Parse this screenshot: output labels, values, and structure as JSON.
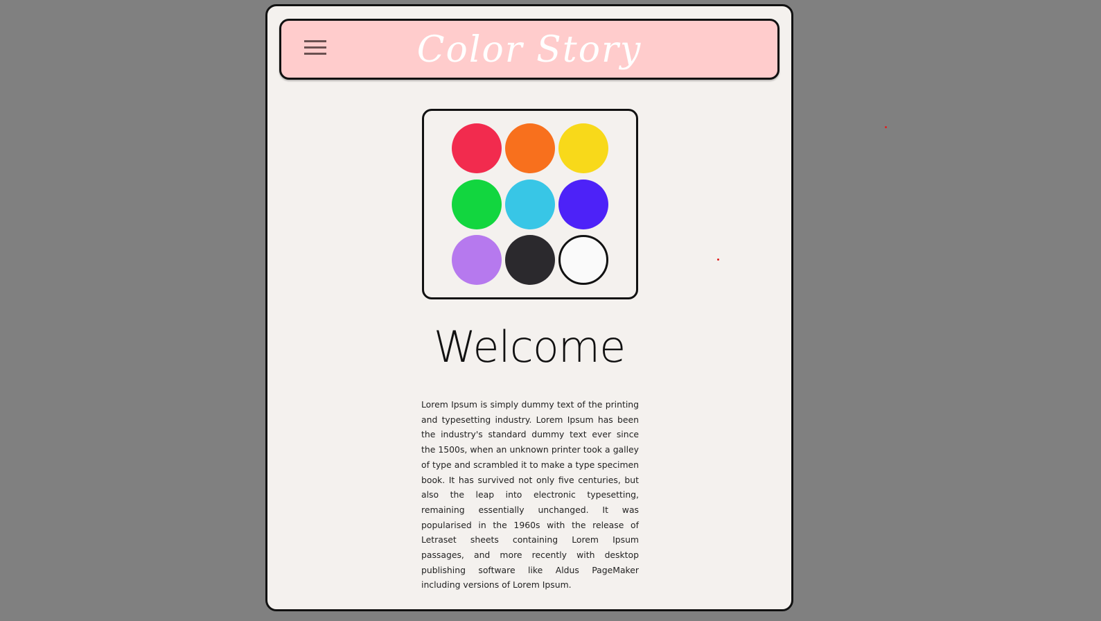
{
  "header": {
    "title": "Color Story",
    "menu_icon": "hamburger-menu-icon"
  },
  "palette": {
    "colors": [
      {
        "name": "red",
        "hex": "#f22b4e"
      },
      {
        "name": "orange",
        "hex": "#f8701d"
      },
      {
        "name": "yellow",
        "hex": "#f8d91a"
      },
      {
        "name": "green",
        "hex": "#12d63f"
      },
      {
        "name": "cyan",
        "hex": "#38c6e6"
      },
      {
        "name": "blue",
        "hex": "#4d22f8"
      },
      {
        "name": "purple",
        "hex": "#b679ee"
      },
      {
        "name": "black",
        "hex": "#2b292d"
      },
      {
        "name": "white",
        "hex": "#fafafa"
      }
    ]
  },
  "main": {
    "heading": "Welcome",
    "paragraph": "Lorem Ipsum is simply dummy text of the printing and typesetting industry. Lorem Ipsum has been the industry's standard dummy text ever since the 1500s, when an unknown printer took a galley of type and scrambled it to make a type specimen book. It has survived not only five centuries, but also the leap into electronic typesetting, remaining essentially unchanged. It was popularised in the 1960s with the release of Letraset sheets containing Lorem Ipsum passages, and more recently with desktop publishing software like Aldus PageMaker including versions of Lorem Ipsum."
  },
  "theme": {
    "page_bg": "#808080",
    "card_bg": "#f4f1ee",
    "header_bg": "#ffcccc",
    "border": "#111111"
  }
}
